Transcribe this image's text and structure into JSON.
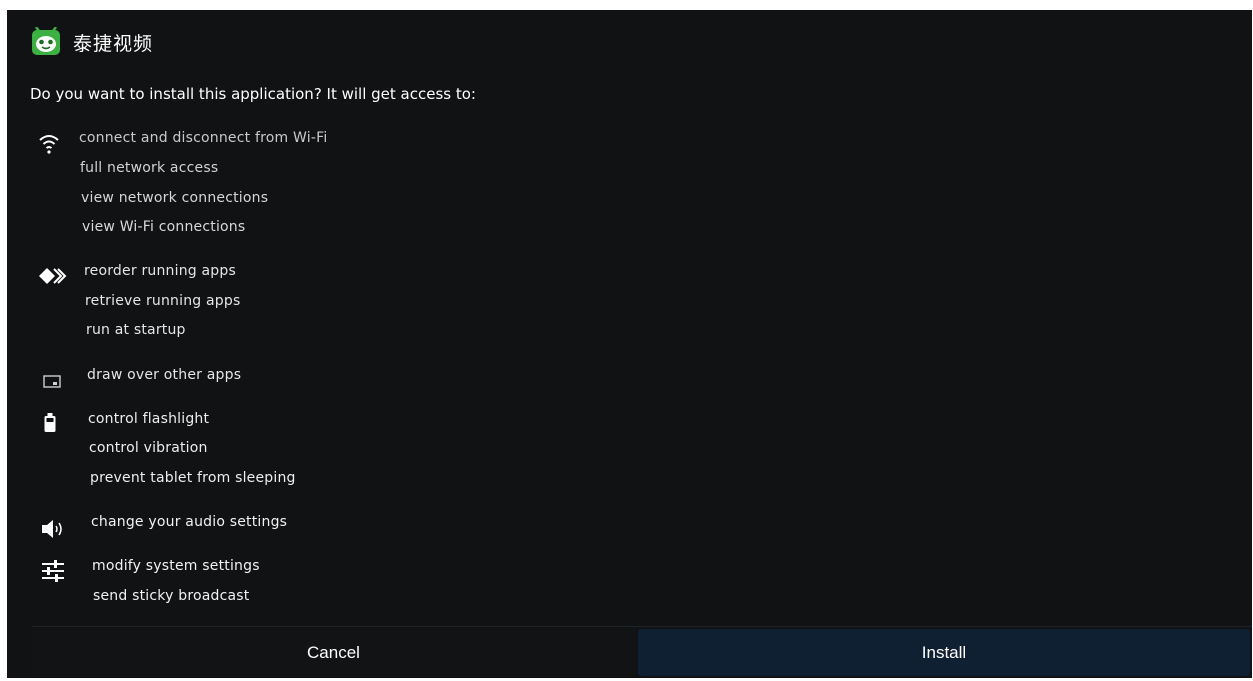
{
  "app": {
    "title": "泰捷视频",
    "icon": "green-robot-app-icon"
  },
  "prompt": "Do you want to install this application? It will get access to:",
  "permission_groups": [
    {
      "icon": "wifi-icon",
      "items": [
        "connect and disconnect from Wi-Fi",
        "full network access",
        "view network connections",
        "view Wi-Fi connections"
      ]
    },
    {
      "icon": "apps-diamond-icon",
      "items": [
        "reorder running apps",
        "retrieve running apps",
        "run at startup"
      ]
    },
    {
      "icon": "window-icon",
      "items": [
        "draw over other apps"
      ]
    },
    {
      "icon": "battery-icon",
      "items": [
        "control flashlight",
        "control vibration",
        "prevent tablet from sleeping"
      ]
    },
    {
      "icon": "speaker-icon",
      "items": [
        "change your audio settings"
      ]
    },
    {
      "icon": "sliders-icon",
      "items": [
        "modify system settings",
        "send sticky broadcast"
      ]
    }
  ],
  "buttons": {
    "cancel": "Cancel",
    "install": "Install"
  },
  "colors": {
    "background": "#111213",
    "install_button": "#102033",
    "app_icon_green": "#3cb043"
  }
}
